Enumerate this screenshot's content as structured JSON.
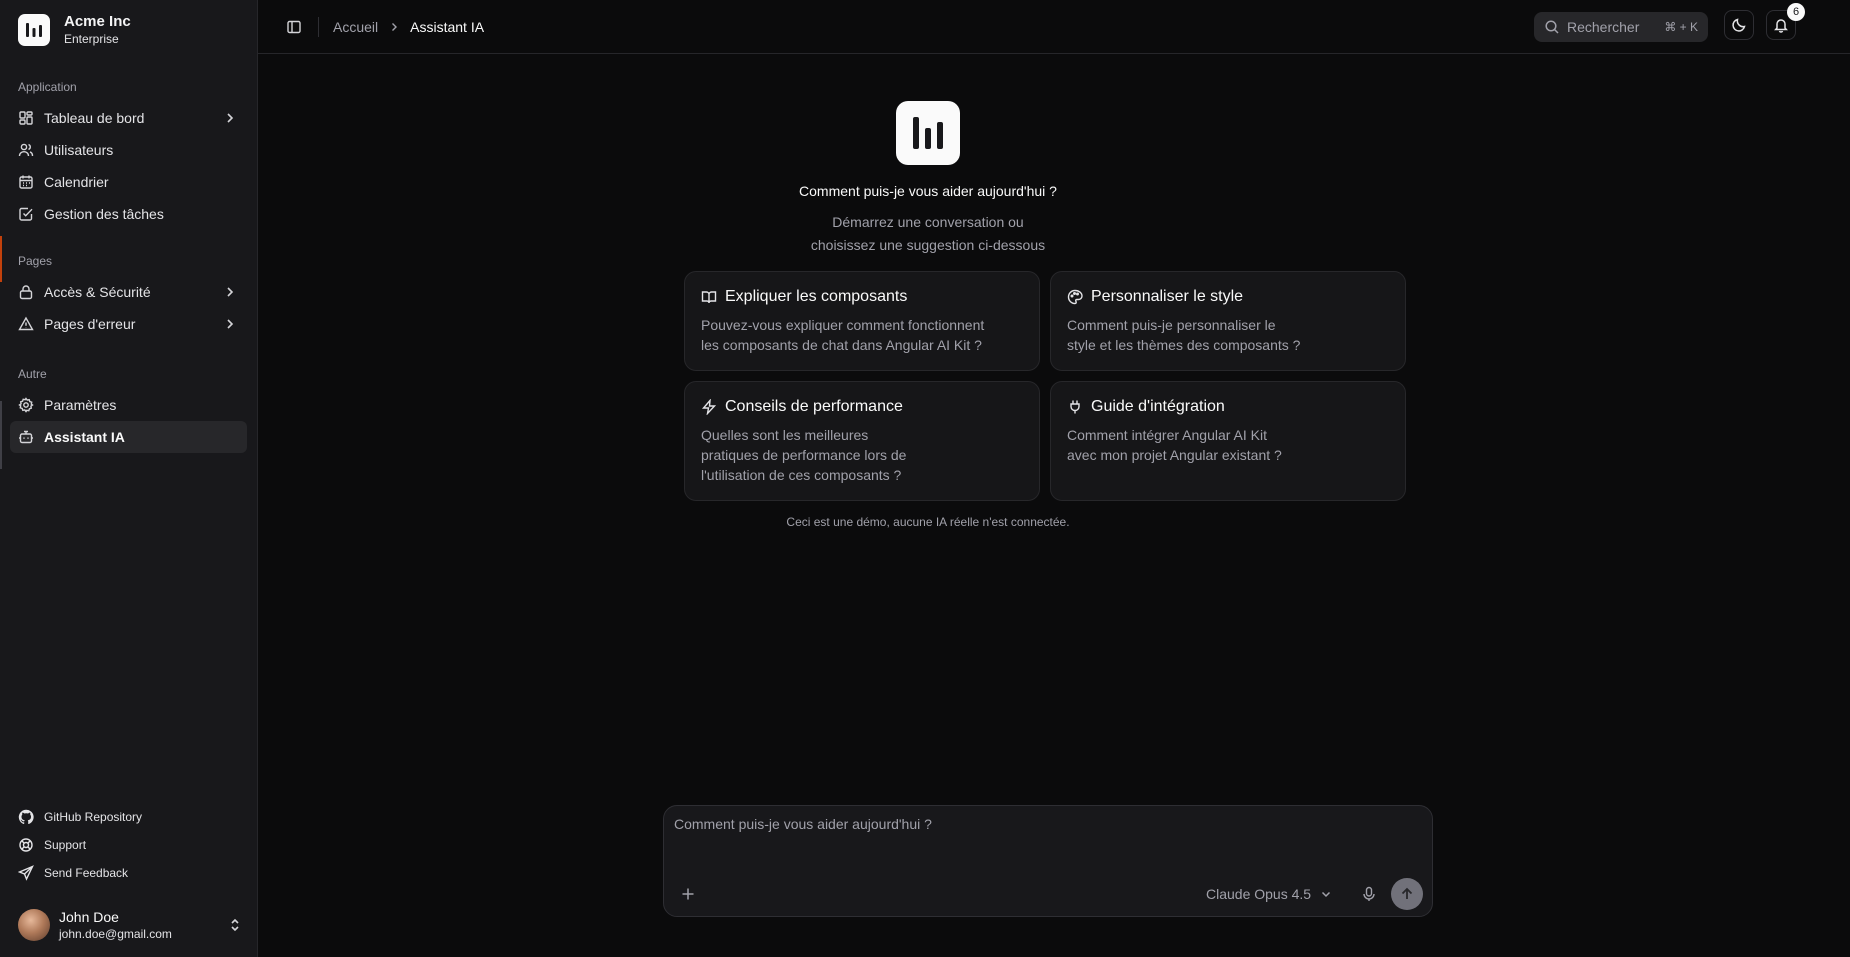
{
  "brand": {
    "name": "Acme Inc",
    "plan": "Enterprise",
    "logo_icon": "bar-chart-logo-icon"
  },
  "sidebar": {
    "groups": [
      {
        "label": "Application",
        "items": [
          {
            "label": "Tableau de bord",
            "icon": "dashboard-icon",
            "has_children": true
          },
          {
            "label": "Utilisateurs",
            "icon": "users-icon"
          },
          {
            "label": "Calendrier",
            "icon": "calendar-icon"
          },
          {
            "label": "Gestion des tâches",
            "icon": "task-check-icon"
          }
        ]
      },
      {
        "label": "Pages",
        "items": [
          {
            "label": "Accès & Sécurité",
            "icon": "lock-icon",
            "has_children": true
          },
          {
            "label": "Pages d'erreur",
            "icon": "warning-triangle-icon",
            "has_children": true
          }
        ]
      },
      {
        "label": "Autre",
        "items": [
          {
            "label": "Paramètres",
            "icon": "gear-icon"
          },
          {
            "label": "Assistant IA",
            "icon": "bot-icon",
            "active": true
          }
        ]
      }
    ],
    "bottom_links": [
      {
        "label": "GitHub Repository",
        "icon": "github-icon"
      },
      {
        "label": "Support",
        "icon": "lifebuoy-icon"
      },
      {
        "label": "Send Feedback",
        "icon": "send-icon"
      }
    ],
    "user": {
      "name": "John Doe",
      "email": "john.doe@gmail.com"
    }
  },
  "topbar": {
    "breadcrumb": {
      "home": "Accueil",
      "current": "Assistant IA"
    },
    "search": {
      "placeholder": "Rechercher",
      "shortcut": "⌘ + K"
    },
    "notifications_count": "6"
  },
  "hero": {
    "title": "Comment puis-je vous aider aujourd'hui ?",
    "subtitle_line1": "Démarrez une conversation ou",
    "subtitle_line2": "choisissez une suggestion ci-dessous"
  },
  "suggestions": [
    {
      "title": "Expliquer les composants",
      "icon": "book-open-icon",
      "lines": [
        "Pouvez-vous expliquer comment fonctionnent",
        "les composants de chat dans Angular AI Kit ?"
      ]
    },
    {
      "title": "Personnaliser le style",
      "icon": "palette-icon",
      "lines": [
        "Comment puis-je personnaliser le",
        "style et les thèmes des composants ?"
      ]
    },
    {
      "title": "Conseils de performance",
      "icon": "lightning-icon",
      "lines": [
        "Quelles sont les meilleures",
        "pratiques de performance lors de",
        "l'utilisation de ces composants ?"
      ]
    },
    {
      "title": "Guide d'intégration",
      "icon": "plug-icon",
      "lines": [
        "Comment intégrer Angular AI Kit",
        "avec mon projet Angular existant ?"
      ]
    }
  ],
  "demo_note": "Ceci est une démo, aucune IA réelle n'est connectée.",
  "composer": {
    "placeholder": "Comment puis-je vous aider aujourd'hui ?",
    "model": "Claude Opus 4.5"
  },
  "colors": {
    "accent": "#c2410c",
    "background": "#0b0b0c",
    "sidebar": "#18181b"
  }
}
